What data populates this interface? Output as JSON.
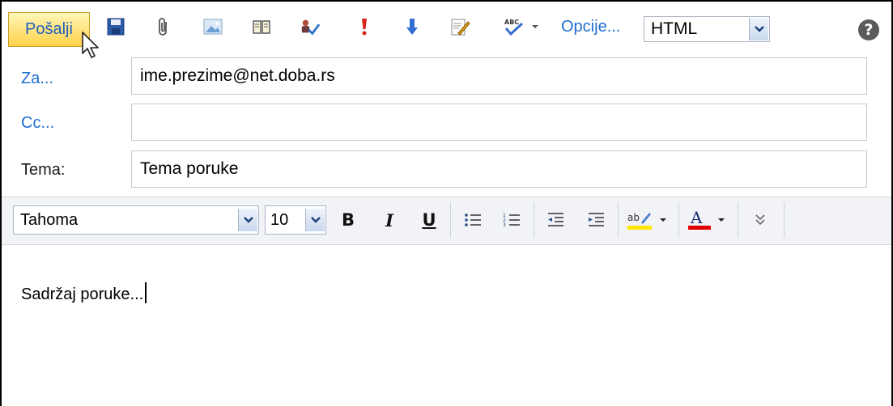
{
  "toolbar": {
    "send_label": "Pošalji",
    "options_label": "Opcije...",
    "format_value": "HTML",
    "help_label": "?"
  },
  "fields": {
    "to": {
      "label": "Za...",
      "value": "ime.prezime@net.doba.rs"
    },
    "cc": {
      "label": "Cc...",
      "value": ""
    },
    "subject": {
      "label": "Tema:",
      "value": "Tema poruke"
    }
  },
  "format_bar": {
    "font": "Tahoma",
    "size": "10",
    "bold": "B",
    "italic": "I",
    "underline": "U",
    "font_color_glyph": "A",
    "highlight_glyph": "ab",
    "more_glyph": "»"
  },
  "body": {
    "text": "Sadržaj poruke..."
  },
  "colors": {
    "link": "#1f6fd0",
    "send_bg": "#ffd24a",
    "highlight": "#ffe600",
    "font_color": "#e00000"
  }
}
